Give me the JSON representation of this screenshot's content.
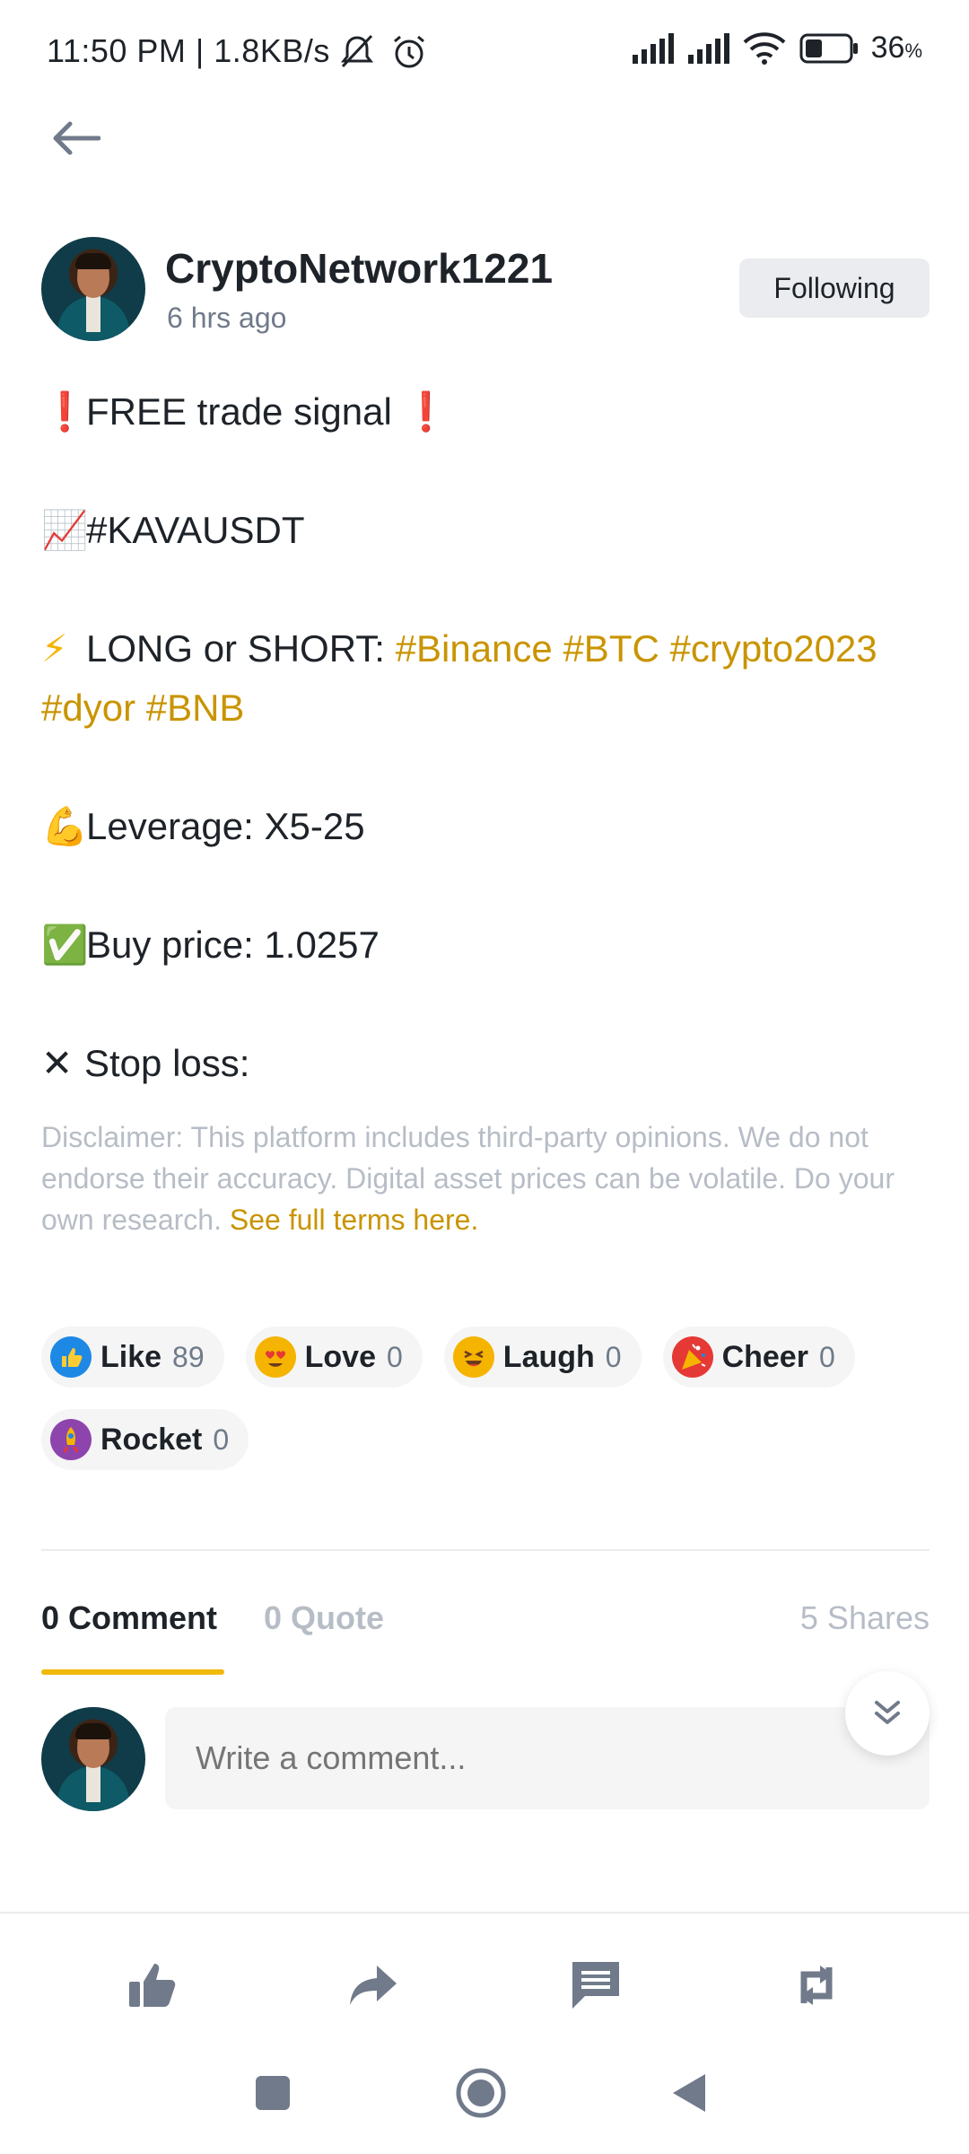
{
  "status_bar": {
    "time_speed": "11:50 PM | 1.8KB/s",
    "battery": "36",
    "battery_unit": "%"
  },
  "post": {
    "author": "CryptoNetwork1221",
    "time": "6 hrs ago",
    "follow_label": "Following",
    "lines": {
      "l1_emoji": "❗",
      "l1_text": "FREE trade signal",
      "l1_emoji_end": "❗",
      "l2_emoji": "📈",
      "l2_text": "#KAVAUSDT",
      "l3_emoji": "⚡",
      "l3_text": "LONG or SHORT:",
      "l3_tags": "#Binance #BTC #crypto2023",
      "l3_tags2": "#dyor #BNB",
      "l4_emoji": "💪",
      "l4_text": "Leverage: X5-25",
      "l5_emoji": "✅",
      "l5_text": "Buy price: 1.0257",
      "l6_emoji": "✕",
      "l6_text": "Stop loss:"
    },
    "disclaimer": "Disclaimer: This platform includes third-party opinions. We do not endorse their accuracy. Digital asset prices can be volatile. Do your own research.",
    "terms_link": "See full terms here."
  },
  "reactions": [
    {
      "label": "Like",
      "count": "89",
      "icon": "thumbs-up-icon",
      "color": "#1e88e5"
    },
    {
      "label": "Love",
      "count": "0",
      "icon": "heart-eyes-icon",
      "color": "#f5b400"
    },
    {
      "label": "Laugh",
      "count": "0",
      "icon": "laugh-icon",
      "color": "#f5b400"
    },
    {
      "label": "Cheer",
      "count": "0",
      "icon": "party-popper-icon",
      "color": "#e53935"
    },
    {
      "label": "Rocket",
      "count": "0",
      "icon": "rocket-icon",
      "color": "#8e44ad"
    }
  ],
  "tabs": {
    "comment": "0 Comment",
    "quote": "0 Quote",
    "shares": "5 Shares"
  },
  "comment_box": {
    "placeholder": "Write a comment..."
  },
  "colors": {
    "accent": "#f0b90b",
    "tag": "#c99400",
    "muted": "#b7bdc6"
  }
}
